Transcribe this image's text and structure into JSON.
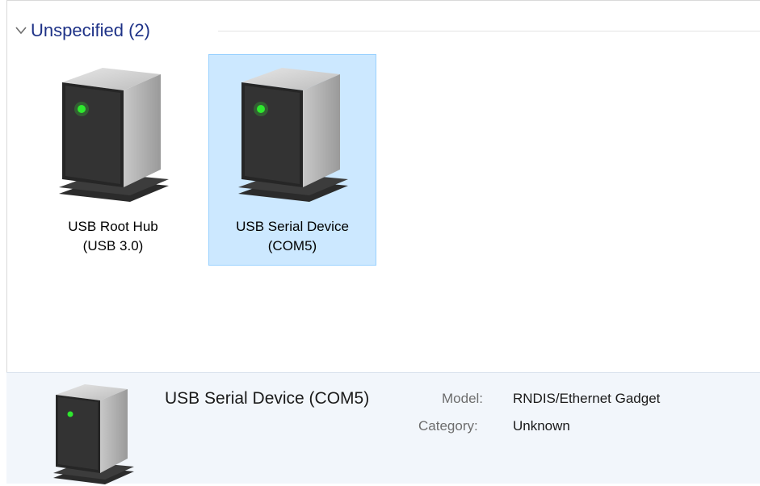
{
  "group": {
    "title": "Unspecified (2)",
    "chevron_icon": "chevron-down-icon"
  },
  "devices": [
    {
      "name_line1": "USB Root Hub",
      "name_line2": "(USB 3.0)",
      "icon": "device-tower-icon",
      "selected": false
    },
    {
      "name_line1": "USB Serial Device",
      "name_line2": "(COM5)",
      "icon": "device-tower-icon",
      "selected": true
    }
  ],
  "details": {
    "name": "USB Serial Device (COM5)",
    "model_label": "Model:",
    "model_value": "RNDIS/Ethernet Gadget",
    "category_label": "Category:",
    "category_value": "Unknown"
  },
  "colors": {
    "selection_bg": "#cce8ff",
    "selection_border": "#99d1ff",
    "group_title": "#1e3287",
    "details_bg": "#f2f6fb"
  }
}
